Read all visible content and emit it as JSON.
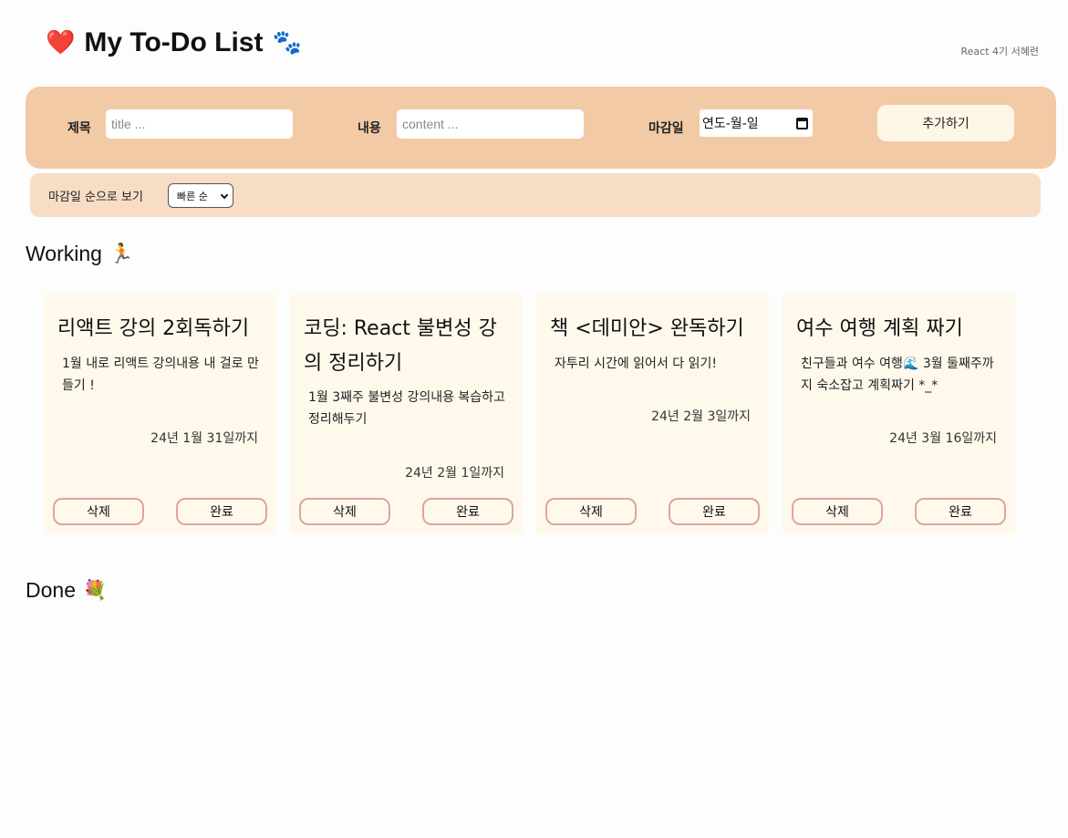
{
  "header": {
    "title": "My To-Do List",
    "left_icon": "❤️",
    "right_icon": "🐾",
    "author": "React 4기 서혜련"
  },
  "form": {
    "title_label": "제목",
    "title_placeholder": "title ...",
    "content_label": "내용",
    "content_placeholder": "content ...",
    "due_label": "마감일",
    "due_value": "연도-월-일",
    "add_label": "추가하기"
  },
  "sort": {
    "label": "마감일 순으로 보기",
    "selected": "빠른 순"
  },
  "working": {
    "title": "Working",
    "emoji": "🏃"
  },
  "done": {
    "title": "Done",
    "emoji": "💐"
  },
  "cards": [
    {
      "title": "리액트 강의 2회독하기",
      "content": "1월 내로 리액트 강의내용 내 걸로 만들기 !",
      "due": "24년 1월 31일까지",
      "delete_label": "삭제",
      "done_label": "완료"
    },
    {
      "title": "코딩: React 불변성 강의 정리하기",
      "content": "1월 3째주 불변성 강의내용 복습하고 정리해두기",
      "due": "24년 2월 1일까지",
      "delete_label": "삭제",
      "done_label": "완료"
    },
    {
      "title": "책 <데미안> 완독하기",
      "content": "자투리 시간에 읽어서 다 읽기!",
      "due": "24년 2월 3일까지",
      "delete_label": "삭제",
      "done_label": "완료"
    },
    {
      "title": "여수 여행 계획 짜기",
      "content": "친구들과 여수 여행🌊 3월 둘째주까지 숙소잡고 계획짜기 *_*",
      "due": "24년 3월 16일까지",
      "delete_label": "삭제",
      "done_label": "완료"
    }
  ],
  "colors": {
    "form_bg": "#f3caa6",
    "sort_bg": "#f7dcc6",
    "card_bg": "#fff9ec",
    "button_border": "#dfa3a0",
    "add_button_bg": "#fff7e6"
  }
}
